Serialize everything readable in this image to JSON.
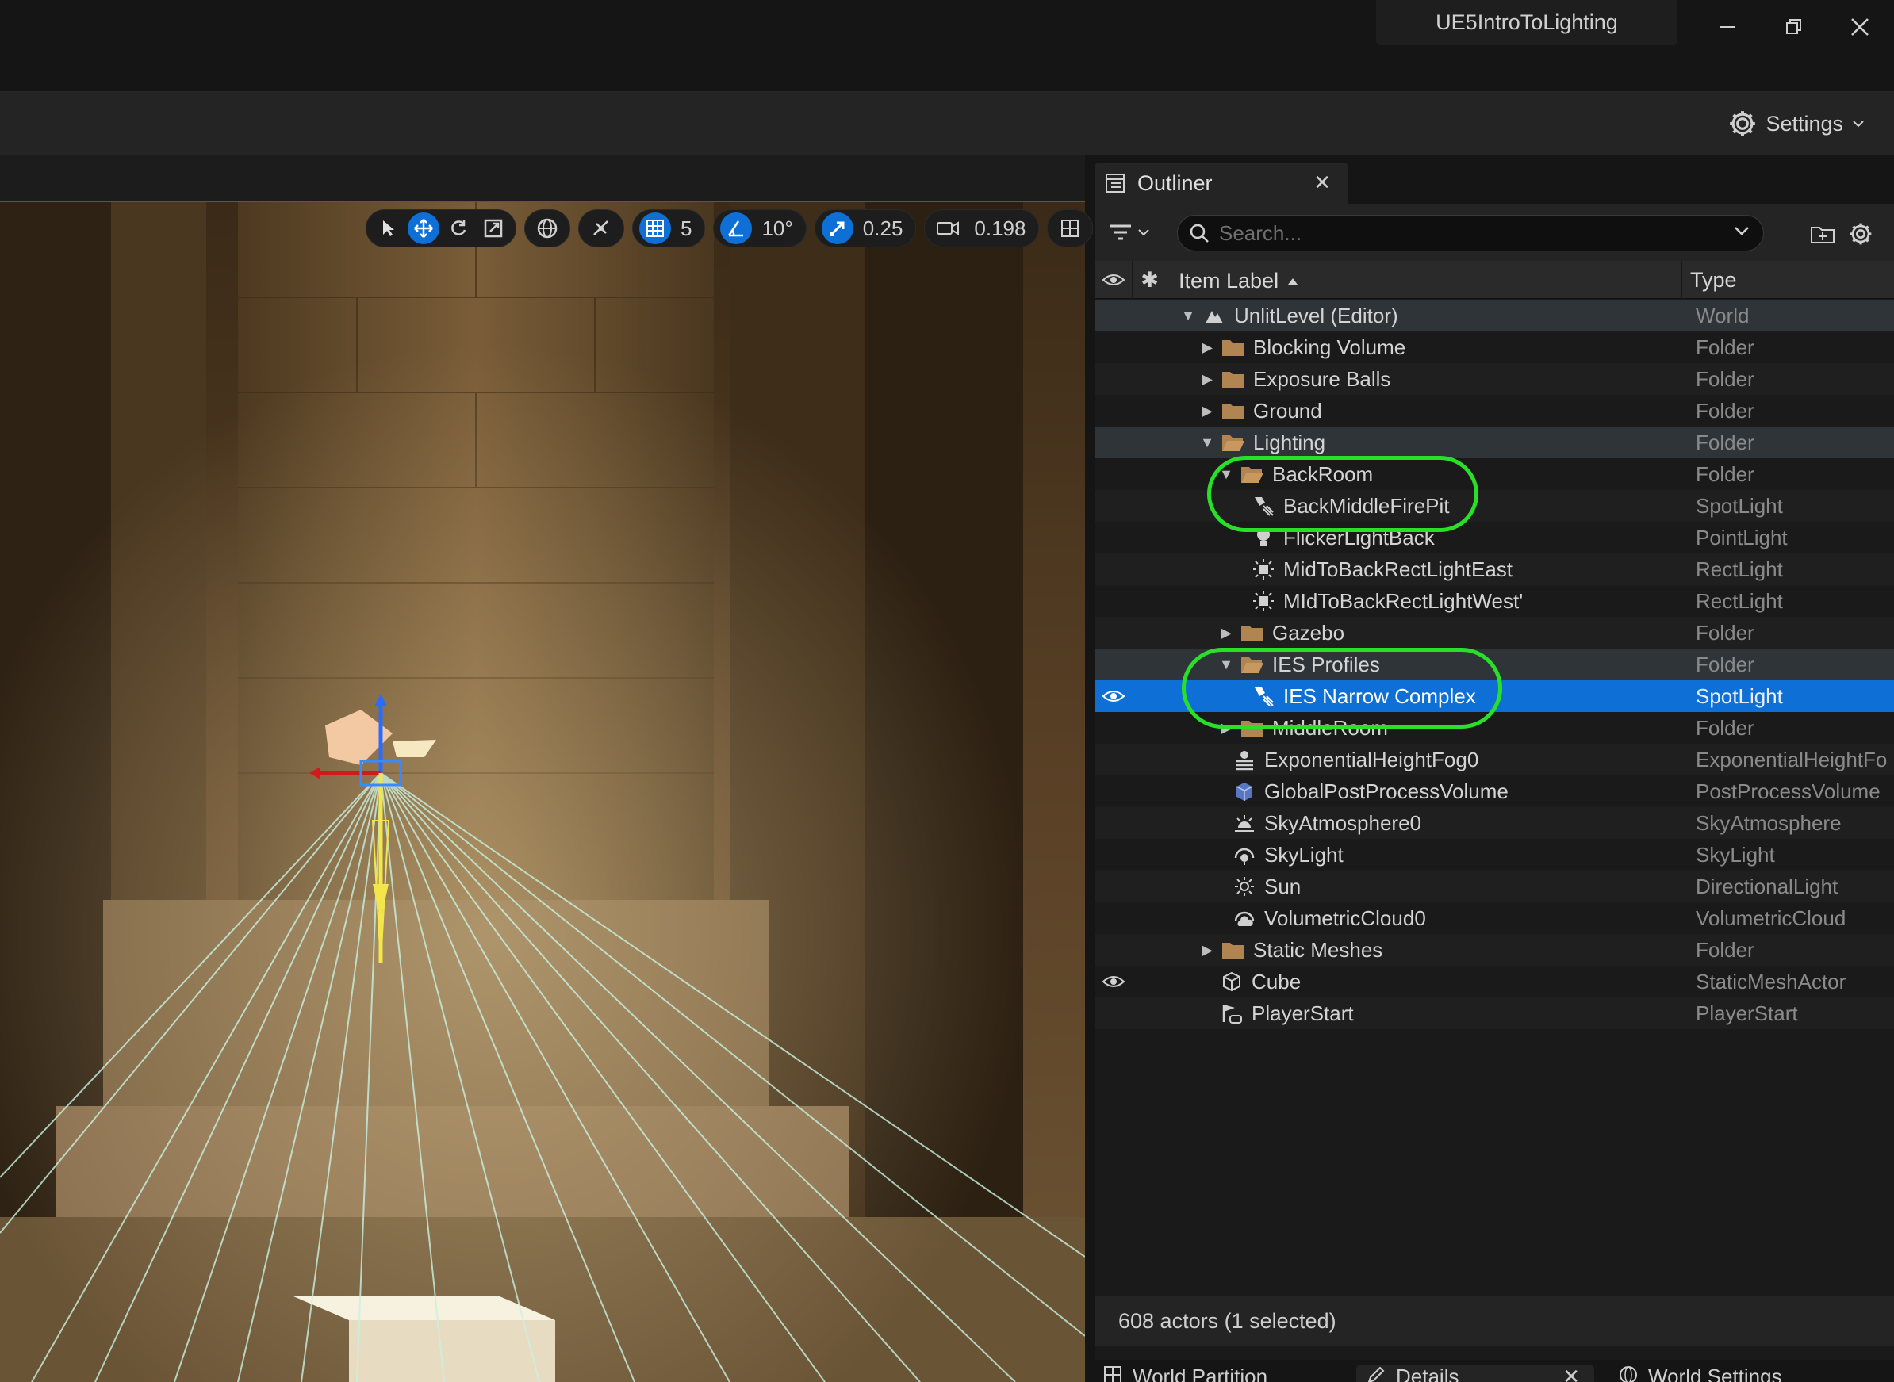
{
  "window": {
    "title": "UE5IntroToLighting"
  },
  "toolbar": {
    "settings_label": "Settings"
  },
  "viewport": {
    "grid_snap": "5",
    "angle_snap": "10°",
    "scale_snap": "0.25",
    "camera_speed": "0.198"
  },
  "outliner": {
    "tab_label": "Outliner",
    "search_placeholder": "Search...",
    "col_label": "Item Label",
    "col_type": "Type",
    "rows": [
      {
        "label": "UnlitLevel (Editor)",
        "type": "World"
      },
      {
        "label": "Blocking Volume",
        "type": "Folder"
      },
      {
        "label": "Exposure Balls",
        "type": "Folder"
      },
      {
        "label": "Ground",
        "type": "Folder"
      },
      {
        "label": "Lighting",
        "type": "Folder"
      },
      {
        "label": "BackRoom",
        "type": "Folder"
      },
      {
        "label": "BackMiddleFirePit",
        "type": "SpotLight"
      },
      {
        "label": "FlickerLightBack",
        "type": "PointLight"
      },
      {
        "label": "MidToBackRectLightEast",
        "type": "RectLight"
      },
      {
        "label": "MIdToBackRectLightWest'",
        "type": "RectLight"
      },
      {
        "label": "Gazebo",
        "type": "Folder"
      },
      {
        "label": "IES Profiles",
        "type": "Folder"
      },
      {
        "label": "IES Narrow Complex",
        "type": "SpotLight"
      },
      {
        "label": "MiddleRoom",
        "type": "Folder"
      },
      {
        "label": "ExponentialHeightFog0",
        "type": "ExponentialHeightFo"
      },
      {
        "label": "GlobalPostProcessVolume",
        "type": "PostProcessVolume"
      },
      {
        "label": "SkyAtmosphere0",
        "type": "SkyAtmosphere"
      },
      {
        "label": "SkyLight",
        "type": "SkyLight"
      },
      {
        "label": "Sun",
        "type": "DirectionalLight"
      },
      {
        "label": "VolumetricCloud0",
        "type": "VolumetricCloud"
      },
      {
        "label": "Static Meshes",
        "type": "Folder"
      },
      {
        "label": "Cube",
        "type": "StaticMeshActor"
      },
      {
        "label": "PlayerStart",
        "type": "PlayerStart"
      }
    ],
    "status": "608 actors (1 selected)",
    "bottom_tabs": [
      "World Partition",
      "Details",
      "World Settings"
    ]
  },
  "colors": {
    "selection": "#0e6fd6",
    "annotation": "#28e028"
  }
}
